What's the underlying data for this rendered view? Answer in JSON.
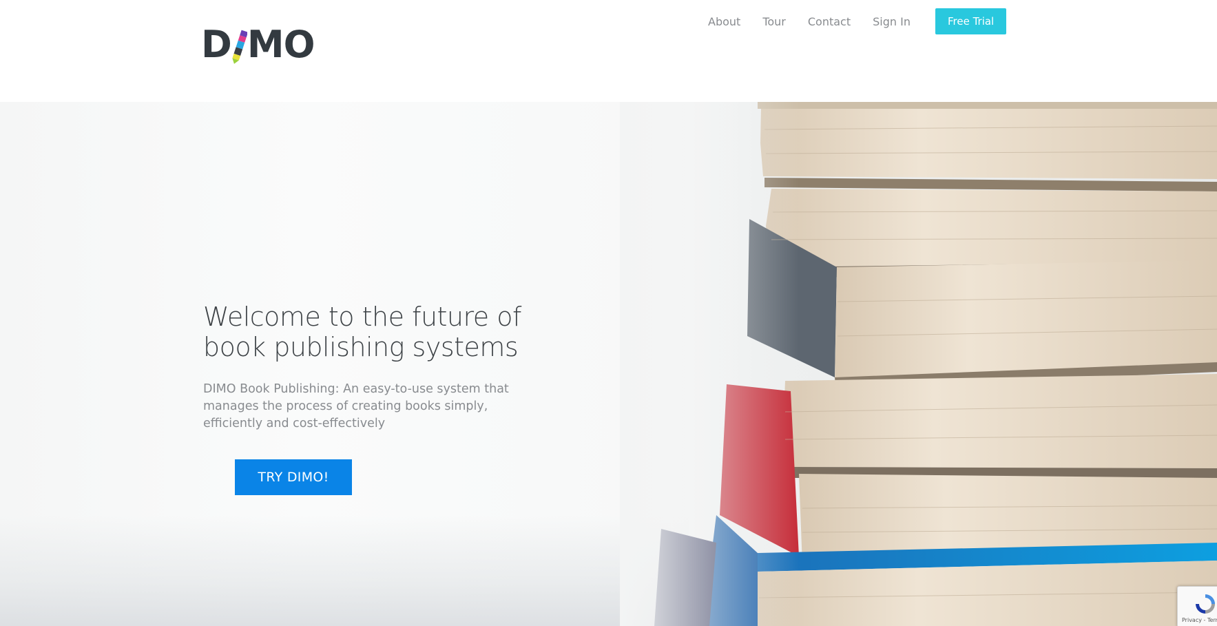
{
  "header": {
    "logo_left": "D",
    "logo_right": "MO",
    "nav": [
      {
        "label": "About"
      },
      {
        "label": "Tour"
      },
      {
        "label": "Contact"
      },
      {
        "label": "Sign In"
      }
    ],
    "cta_label": "Free Trial"
  },
  "hero": {
    "title": "Welcome to the future of book publishing systems",
    "subtitle": "DIMO Book Publishing: An easy-to-use system that manages the process of creating books simply, efficiently and cost-effectively",
    "button_label": "TRY DIMO!",
    "background_image": "stack-of-books"
  },
  "recaptcha": {
    "icon": "recaptcha-icon",
    "text": "Privacy - Terms"
  },
  "colors": {
    "accent_cyan": "#29c8de",
    "primary_blue": "#0a84e7",
    "logo_dark": "#333a40",
    "nav_gray": "#888b8f",
    "heading": "#3d4246"
  },
  "icons": [
    "pen-icon",
    "recaptcha-icon"
  ]
}
